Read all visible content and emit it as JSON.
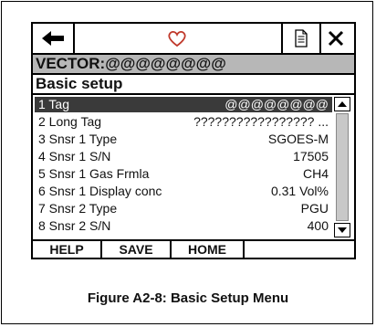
{
  "header": {
    "title": "VECTOR:@@@@@@@@",
    "subtitle": "Basic setup"
  },
  "toolbar": {
    "back_icon": "back-arrow-icon",
    "favorite_icon": "heart-icon",
    "document_icon": "document-icon",
    "close_icon": "close-icon",
    "accent_color": "#c0392b"
  },
  "menu_items": [
    {
      "label": "1 Tag",
      "value": "@@@@@@@@",
      "selected": true
    },
    {
      "label": "2 Long Tag",
      "value": "????????????????? ..."
    },
    {
      "label": "3 Snsr 1 Type",
      "value": "SGOES-M"
    },
    {
      "label": "4 Snsr 1 S/N",
      "value": "17505"
    },
    {
      "label": "5 Snsr 1 Gas Frmla",
      "value": "CH4"
    },
    {
      "label": "6 Snsr 1 Display conc",
      "value": "0.31 Vol%"
    },
    {
      "label": "7 Snsr 2 Type",
      "value": "PGU"
    },
    {
      "label": "8 Snsr 2 S/N",
      "value": "400"
    }
  ],
  "softkeys": {
    "help": "HELP",
    "save": "SAVE",
    "home": "HOME"
  },
  "caption": "Figure A2-8: Basic Setup Menu"
}
